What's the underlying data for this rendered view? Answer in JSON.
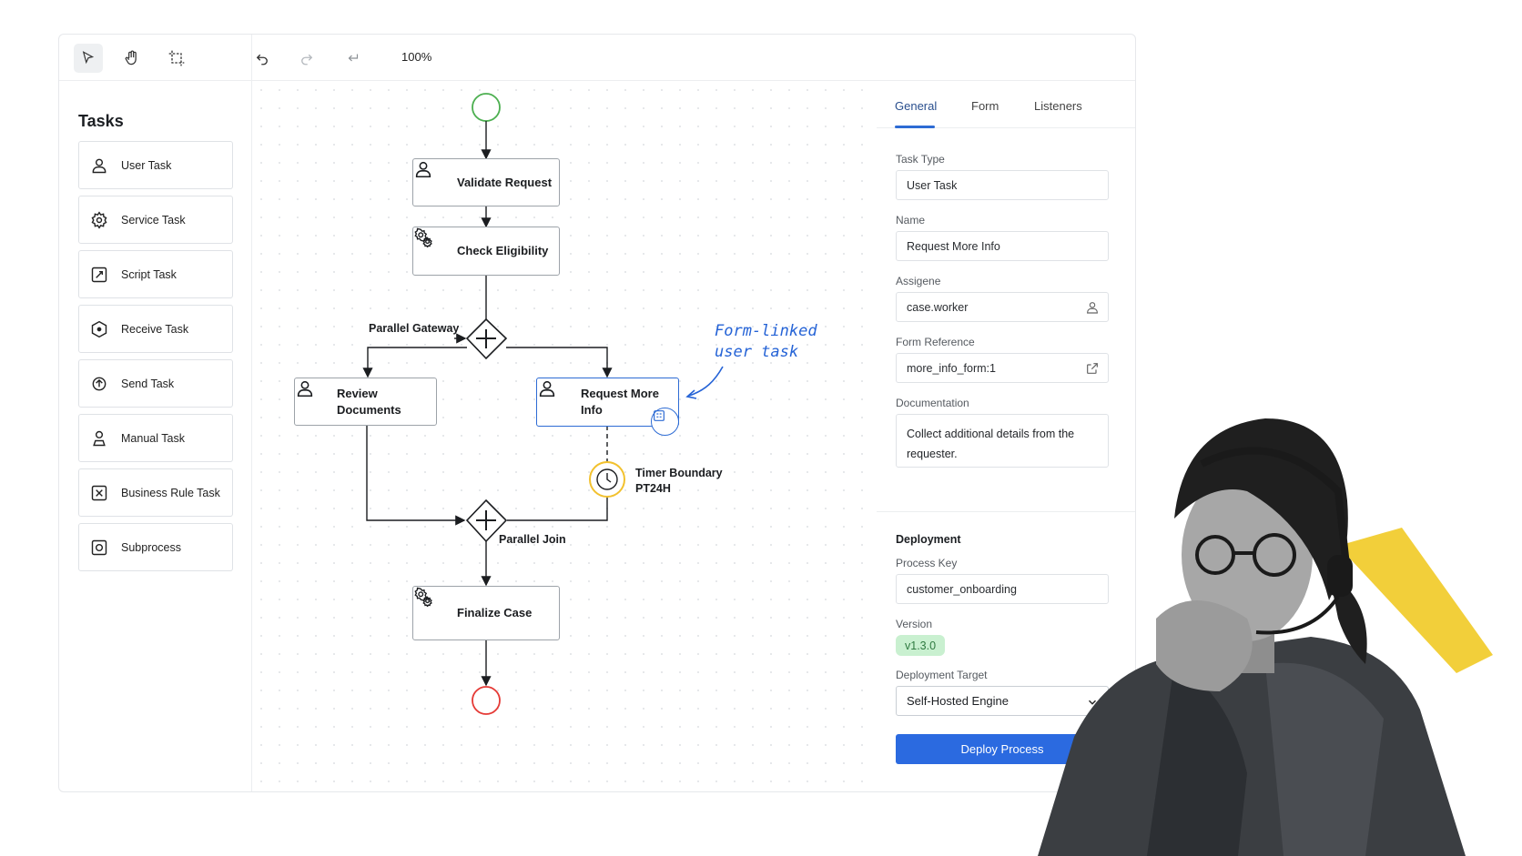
{
  "toolbar": {
    "tools": [
      {
        "name": "select-tool",
        "icon": "cursor-icon"
      },
      {
        "name": "pan-tool",
        "icon": "hand-icon"
      },
      {
        "name": "crop-tool",
        "icon": "crop-icon"
      }
    ],
    "zoom_label": "100%"
  },
  "sidebar": {
    "title": "Tasks",
    "items": [
      {
        "label": "User Task",
        "icon": "user-icon"
      },
      {
        "label": "Service Task",
        "icon": "gear-icon"
      },
      {
        "label": "Script Task",
        "icon": "script-icon"
      },
      {
        "label": "Receive Task",
        "icon": "receive-icon"
      },
      {
        "label": "Send Task",
        "icon": "send-icon"
      },
      {
        "label": "Manual Task",
        "icon": "hand-task-icon"
      },
      {
        "label": "Business Rule Task",
        "icon": "rule-icon"
      },
      {
        "label": "Subprocess",
        "icon": "subprocess-icon"
      }
    ]
  },
  "diagram": {
    "nodes": {
      "validate": "Validate Request",
      "check": "Check Eligibility",
      "review": "Review Documents",
      "request_more": "Request More Info",
      "finalize": "Finalize Case"
    },
    "labels": {
      "parallel_gateway": "Parallel Gateway",
      "parallel_join": "Parallel Join",
      "timer_line1": "Timer Boundary",
      "timer_line2": "PT24H"
    },
    "annotation_line1": "Form-linked",
    "annotation_line2": "user task"
  },
  "properties": {
    "tabs": [
      "General",
      "Form",
      "Listeners"
    ],
    "active_tab": "General",
    "task_type_label": "Task Type",
    "task_type_value": "User Task",
    "name_label": "Name",
    "name_value": "Request More Info",
    "assignee_label": "Assigene",
    "assignee_value": "case.worker",
    "form_ref_label": "Form Reference",
    "form_ref_value": "more_info_form:1",
    "documentation_label": "Documentation",
    "documentation_value": "Collect additional details from the requester.",
    "deployment_title": "Deployment",
    "process_key_label": "Process Key",
    "process_key_value": "customer_onboarding",
    "version_label": "Version",
    "version_value": "v1.3.0",
    "target_label": "Deployment Target",
    "target_value": "Self-Hosted Engine",
    "deploy_button": "Deploy Process"
  },
  "colors": {
    "accent": "#2b6ae0",
    "start_event": "#4caf50",
    "end_event": "#e53935",
    "timer": "#f2c12e",
    "version_badge_bg": "#c9f0d0"
  }
}
